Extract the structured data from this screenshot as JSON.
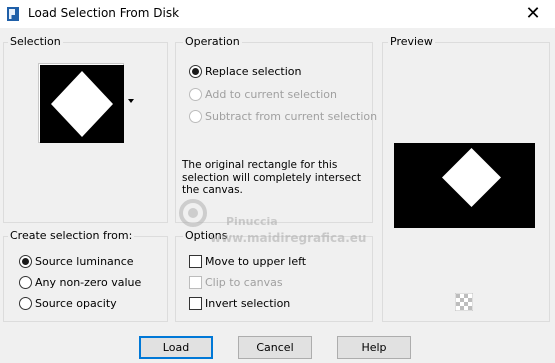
{
  "window": {
    "title": "Load Selection From Disk",
    "close_glyph": "✕"
  },
  "groups": {
    "selection": "Selection",
    "operation": "Operation",
    "preview": "Preview",
    "create_from": "Create selection from:",
    "options": "Options"
  },
  "operation": {
    "items": [
      {
        "label": "Replace selection",
        "checked": true,
        "enabled": true
      },
      {
        "label": "Add to current selection",
        "checked": false,
        "enabled": false
      },
      {
        "label": "Subtract from current selection",
        "checked": false,
        "enabled": false
      }
    ],
    "info": "The original rectangle for this selection will completely intersect the canvas."
  },
  "create_from": {
    "items": [
      {
        "label": "Source luminance",
        "checked": true
      },
      {
        "label": "Any non-zero value",
        "checked": false
      },
      {
        "label": "Source opacity",
        "checked": false
      }
    ]
  },
  "options": {
    "items": [
      {
        "label": "Move to upper left",
        "checked": false,
        "enabled": true
      },
      {
        "label": "Clip to canvas",
        "checked": false,
        "enabled": false
      },
      {
        "label": "Invert selection",
        "checked": false,
        "enabled": true
      }
    ]
  },
  "buttons": {
    "load": "Load",
    "cancel": "Cancel",
    "help": "Help"
  },
  "watermark": {
    "name": "Pinuccia",
    "site": "www.maidiregrafica.eu"
  },
  "icons": {
    "app": "psp-icon",
    "dropdown": "dropdown-arrow-icon",
    "checker": "checkerboard-icon",
    "close": "close-icon"
  }
}
